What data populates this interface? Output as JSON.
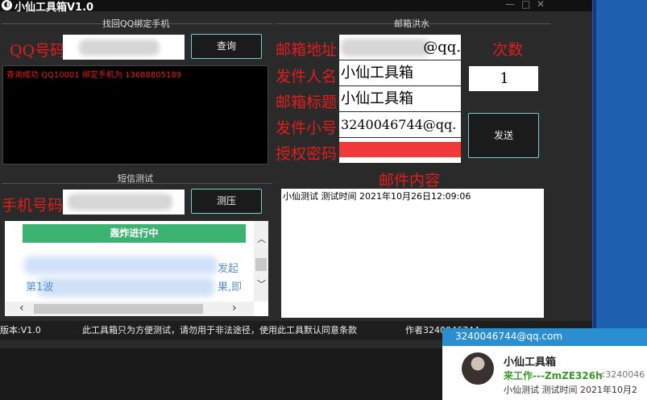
{
  "app": {
    "title": "小仙工具箱V1.0",
    "icon": "app-logo-icon"
  },
  "window_controls": {
    "minimize": "—",
    "maximize": "□",
    "close": "✕"
  },
  "qq_section": {
    "group_title": "找回QQ绑定手机",
    "qq_label": "QQ号码",
    "query_button": "查询",
    "log_text": "查询成功 QQ10001 绑定手机为 13688805189"
  },
  "sms_section": {
    "group_title": "短信测试",
    "phone_label": "手机号码",
    "test_button": "测压",
    "web_banner": "轰炸进行中",
    "web_text_right": "发起",
    "web_text_line2_left": "第1波",
    "web_text_line2_right": "果,即"
  },
  "mail_section": {
    "group_title": "邮箱洪水",
    "address_label": "邮箱地址",
    "address_value": "@qq.",
    "sender_name_label": "发件人名",
    "sender_name_value": "小仙工具箱",
    "subject_label": "邮箱标题",
    "subject_value": "小仙工具箱",
    "sender_account_label": "发件小号",
    "sender_account_value": "3240046744@qq.",
    "auth_code_label": "授权密码",
    "count_label": "次数",
    "count_value": "1",
    "send_button": "发送",
    "content_label": "邮件内容",
    "content_value": "小仙测试  测试时间 2021年10月26日12:09:06"
  },
  "status_bar": {
    "version": "版本:V1.0",
    "disclaimer": "此工具箱只为方便测试，请勿用于非法途径，使用此工具默认同意条款",
    "author": "作者3240046744"
  },
  "notification": {
    "email": "3240046744@qq.com",
    "title": "小仙工具箱",
    "from_name": "来工作---ZmZE326h",
    "from_addr": "<3240046",
    "preview": "小仙测试  测试时间 2021年10月2"
  },
  "colors": {
    "label_red": "#e01e1e",
    "auth_red": "#f03a3a",
    "banner_green": "#3cb371",
    "notif_blue": "#2a8fd0"
  }
}
